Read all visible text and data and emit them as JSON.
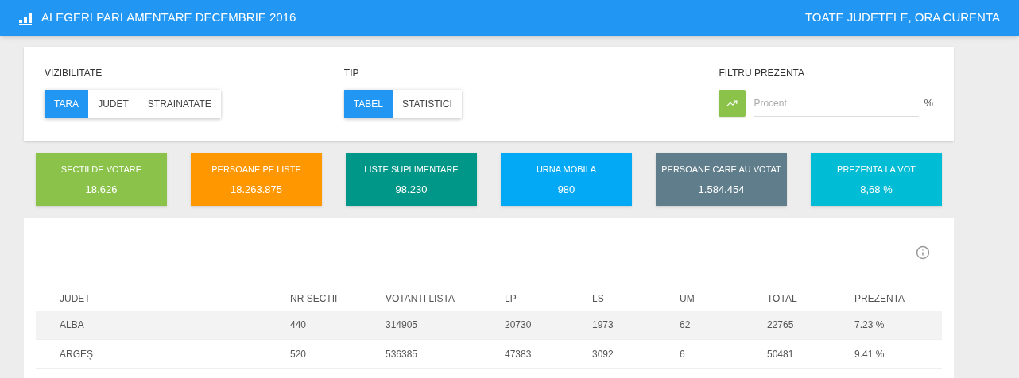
{
  "header": {
    "title": "ALEGERI PARLAMENTARE DECEMBRIE 2016",
    "scope": "TOATE JUDETELE, ORA CURENTA"
  },
  "filters": [
    {
      "label": "VIZIBILITATE",
      "options": [
        {
          "label": "TARA",
          "selected": true
        },
        {
          "label": "JUDET",
          "selected": false
        },
        {
          "label": "STRAINATATE",
          "selected": false
        }
      ]
    },
    {
      "label": "TIP",
      "options": [
        {
          "label": "TABEL",
          "selected": true
        },
        {
          "label": "STATISTICI",
          "selected": false
        }
      ]
    }
  ],
  "presence_filter": {
    "label": "FILTRU PREZENTA",
    "placeholder": "Procent",
    "unit": "%"
  },
  "stats": [
    {
      "label": "SECTII DE VOTARE",
      "value": "18.626",
      "color": "#8bc34a"
    },
    {
      "label": "PERSOANE PE LISTE",
      "value": "18.263.875",
      "color": "#ff9800"
    },
    {
      "label": "LISTE SUPLIMENTARE",
      "value": "98.230",
      "color": "#009688"
    },
    {
      "label": "URNA MOBILA",
      "value": "980",
      "color": "#03a9f4"
    },
    {
      "label": "PERSOANE CARE AU VOTAT",
      "value": "1.584.454",
      "color": "#607d8b"
    },
    {
      "label": "PREZENTA LA VOT",
      "value": "8,68 %",
      "color": "#00bcd4"
    }
  ],
  "table": {
    "columns": [
      "JUDET",
      "NR SECTII",
      "VOTANTI LISTA",
      "LP",
      "LS",
      "UM",
      "TOTAL",
      "PREZENTA"
    ],
    "rows": [
      [
        "ALBA",
        "440",
        "314905",
        "20730",
        "1973",
        "62",
        "22765",
        "7.23 %"
      ],
      [
        "ARGEȘ",
        "520",
        "536385",
        "47383",
        "3092",
        "6",
        "50481",
        "9.41 %"
      ]
    ]
  }
}
